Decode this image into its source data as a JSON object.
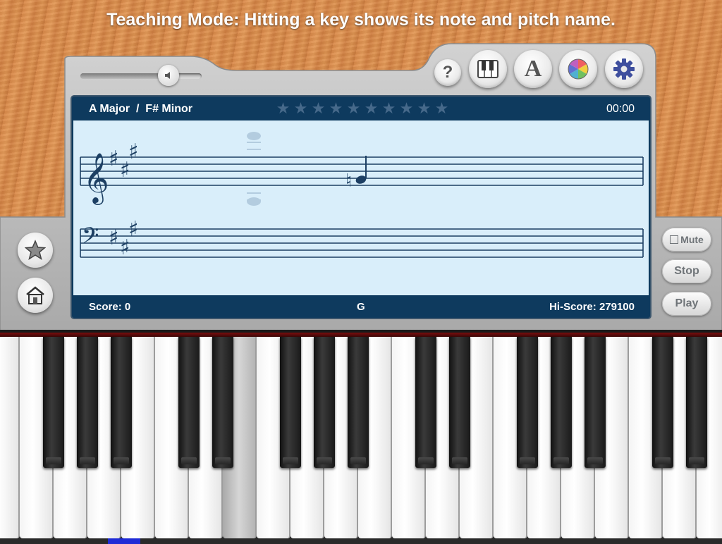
{
  "banner": {
    "text": "Teaching Mode: Hitting a key shows its note and pitch name."
  },
  "toolbar": {
    "volume_level": 0.68,
    "help_label": "?",
    "font_label": "A"
  },
  "screen": {
    "key_signature": "A Major  /  F# Minor",
    "stars_total": 10,
    "stars_earned": 0,
    "timer": "00:00",
    "score": "Score: 0",
    "current_note": "G",
    "hiscore": "Hi-Score: 279100"
  },
  "right_buttons": {
    "mute_label": "Mute",
    "stop_label": "Stop",
    "play_label": "Play"
  },
  "colors": {
    "screen_bg": "#0e3a5e",
    "staff_bg": "#d9eefa",
    "note_color": "#1c3f63",
    "key_marker": "#1f2bd6"
  },
  "icons": {
    "volume": "speaker-icon",
    "help": "question-icon",
    "keyboard": "piano-icon",
    "font": "letter-a-icon",
    "color": "color-wheel-icon",
    "settings": "gear-icon",
    "favorite": "star-icon",
    "home": "home-icon"
  }
}
